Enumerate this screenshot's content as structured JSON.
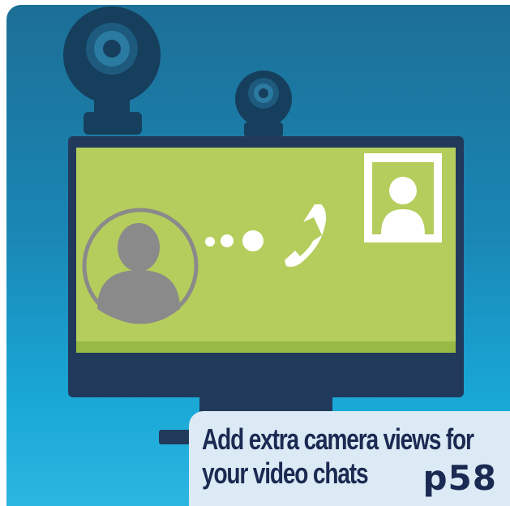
{
  "caption": {
    "line1": "Add extra camera views for",
    "line2": "your video chats",
    "page_ref": "p58"
  },
  "colors": {
    "background_top": "#1c6f96",
    "background_bottom": "#2ab6e0",
    "monitor_frame": "#213a5c",
    "screen": "#b5cd5c",
    "screen_bottom_band": "#97ba44",
    "webcam": "#163f5d",
    "avatar_grey": "#8a8a8a",
    "caption_bg": "#dbeaf4",
    "caption_text": "#1b2a52"
  },
  "icons": [
    "webcam-large-icon",
    "webcam-small-icon",
    "caller-avatar-icon",
    "contact-card-icon",
    "phone-icon"
  ]
}
